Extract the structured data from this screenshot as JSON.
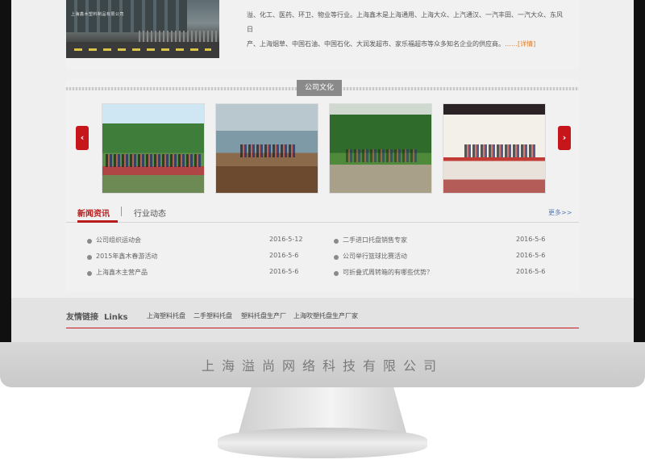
{
  "about": {
    "photo_sign": "上海鑫木塑料制品有限公司",
    "text_line1": "溢、化工、医药、环卫、物业等行业。上海鑫木是上海通用、上海大众、上汽通汉、一汽丰田、一汽大众、东风日",
    "text_line2": "产、上海烟草、中国石油、中国石化、大润发超市、家乐福超市等众多知名企业的供应商。",
    "more": "……[详情]"
  },
  "culture": {
    "tag": "公司文化",
    "prev": "‹",
    "next": "›"
  },
  "news": {
    "tab_news": "新闻资讯",
    "tab_industry": "行业动态",
    "more": "更多>>",
    "left_items": [
      {
        "title": "公司组织运动会",
        "date": "2016-5-12"
      },
      {
        "title": "2015年鑫木春游活动",
        "date": "2016-5-6"
      },
      {
        "title": "上海鑫木主营产品",
        "date": "2016-5-6"
      }
    ],
    "right_items": [
      {
        "title": "二手进口托盘销售专家",
        "date": "2016-5-6"
      },
      {
        "title": "公司举行篮球比赛活动",
        "date": "2016-5-6"
      },
      {
        "title": "可折叠式周转箱的有哪些优势？",
        "date": "2016-5-6"
      }
    ]
  },
  "links": {
    "title_cn": "友情链接",
    "title_en": "Links",
    "items": [
      "上海塑料托盘",
      "二手塑料托盘",
      "塑料托盘生产厂",
      "上海吹塑托盘生产厂家"
    ]
  },
  "monitor": {
    "brand_text": "上海溢尚网络科技有限公司"
  },
  "colors": {
    "accent_red": "#c6161c",
    "news_red": "#b71c1c",
    "more_orange": "#e27b1f",
    "link_blue": "#5b79b5"
  }
}
